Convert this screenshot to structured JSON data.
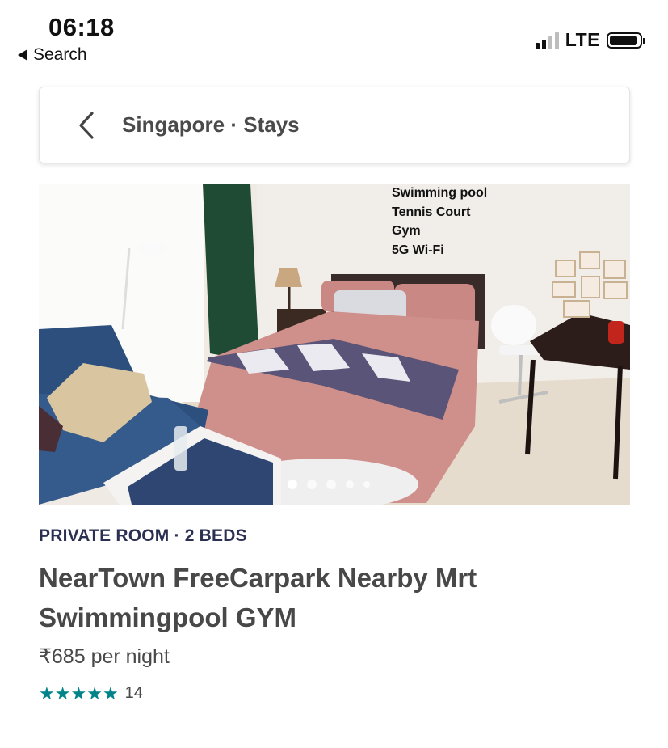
{
  "status_bar": {
    "time": "06:18",
    "back_app_label": "Search",
    "network": "LTE",
    "signal_bars_filled": 2,
    "signal_bars_total": 4
  },
  "search_bar": {
    "title": "Singapore · Stays",
    "back_icon": "chevron-left-icon"
  },
  "photo": {
    "amenities": [
      "Swimming pool",
      "Tennis Court",
      "Gym",
      "5G Wi-Fi"
    ],
    "carousel_total_dots": 5,
    "carousel_active_index": 0
  },
  "listing": {
    "kicker": "PRIVATE ROOM · 2 BEDS",
    "title": "NearTown FreeCarpark Nearby Mrt Swimmingpool GYM",
    "price": "₹685 per night",
    "rating_stars": 5,
    "review_count": "14"
  },
  "colors": {
    "accent_teal": "#008489",
    "kicker_navy": "#2b3052",
    "text_gray": "#484848"
  }
}
